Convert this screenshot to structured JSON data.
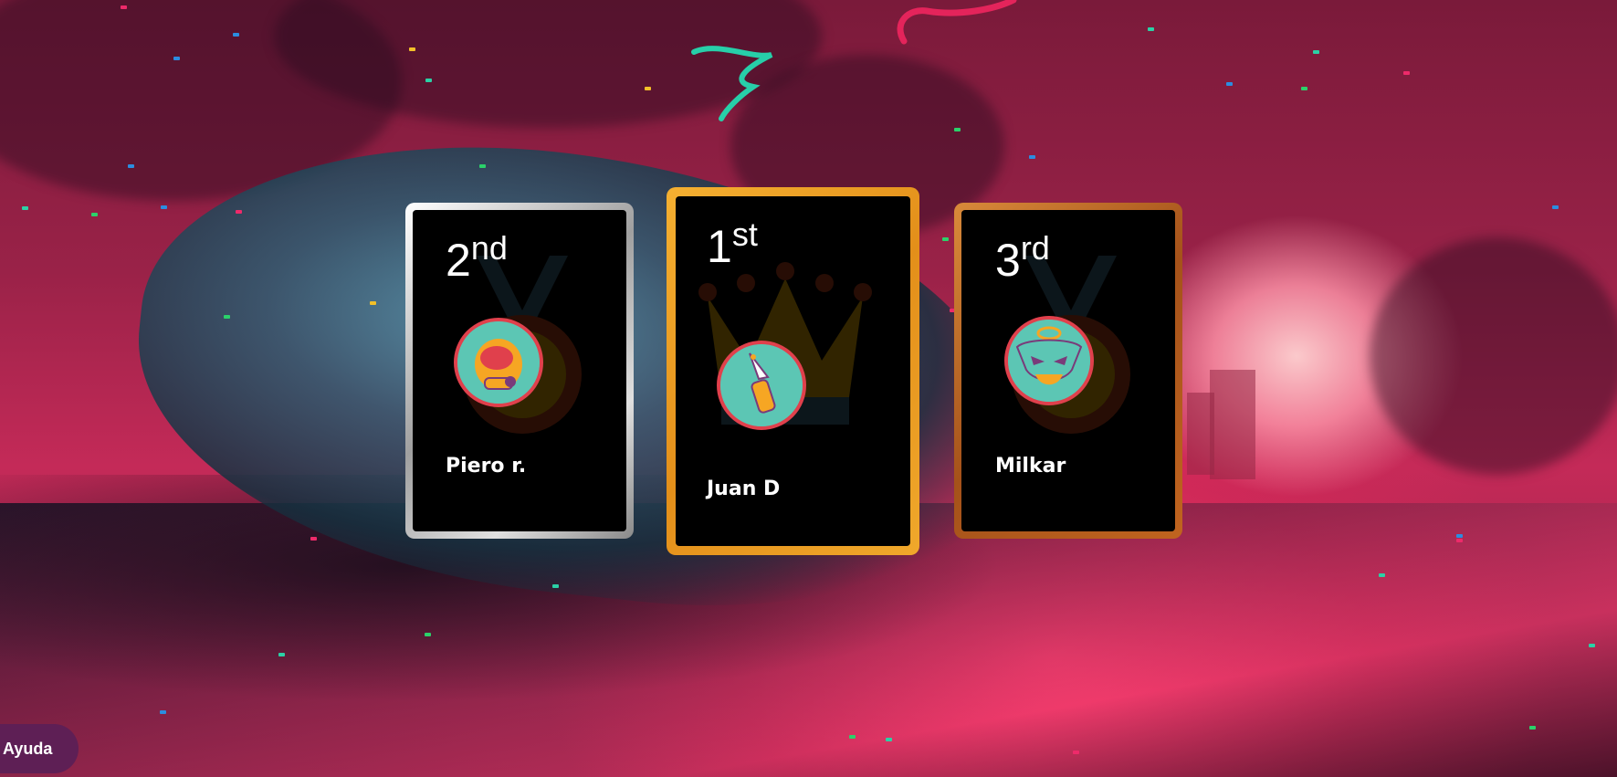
{
  "podium": [
    {
      "place": "2",
      "suffix": "nd",
      "name": "Piero r.",
      "avatar_icon": "astronaut-helmet-icon",
      "frame_color": "#c9c9c9"
    },
    {
      "place": "1",
      "suffix": "st",
      "name": "Juan D",
      "avatar_icon": "rocket-bottle-icon",
      "frame_color": "#e9a12a"
    },
    {
      "place": "3",
      "suffix": "rd",
      "name": "Milkar",
      "avatar_icon": "alien-skull-icon",
      "frame_color": "#c26a22"
    }
  ],
  "help_button": {
    "label": "Ayuda"
  },
  "colors": {
    "background": "#9a2248",
    "card": "#000000",
    "help_bg": "#5e1f55",
    "avatar_bg": "#5cc6b4",
    "avatar_border": "#e0404c"
  }
}
